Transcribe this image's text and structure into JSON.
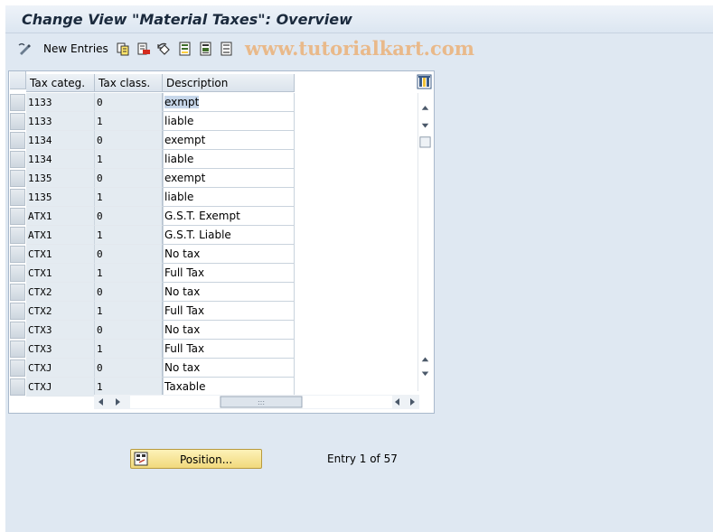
{
  "window": {
    "title": "Change View \"Material Taxes\": Overview"
  },
  "toolbar": {
    "new_entries_label": "New Entries",
    "watermark": "www.tutorialkart.com",
    "icons": [
      "edit-pen-icon",
      "copy-icon",
      "delete-icon",
      "undo-icon",
      "select-all-icon",
      "select-block-icon",
      "deselect-all-icon"
    ]
  },
  "table": {
    "headers": {
      "tax_categ": "Tax categ.",
      "tax_class": "Tax class.",
      "description": "Description"
    },
    "rows": [
      {
        "tax_categ": "1133",
        "tax_class": "0",
        "description": "exmpt"
      },
      {
        "tax_categ": "1133",
        "tax_class": "1",
        "description": "liable"
      },
      {
        "tax_categ": "1134",
        "tax_class": "0",
        "description": "exempt"
      },
      {
        "tax_categ": "1134",
        "tax_class": "1",
        "description": "liable"
      },
      {
        "tax_categ": "1135",
        "tax_class": "0",
        "description": "exempt"
      },
      {
        "tax_categ": "1135",
        "tax_class": "1",
        "description": "liable"
      },
      {
        "tax_categ": "ATX1",
        "tax_class": "0",
        "description": "G.S.T. Exempt"
      },
      {
        "tax_categ": "ATX1",
        "tax_class": "1",
        "description": "G.S.T. Liable"
      },
      {
        "tax_categ": "CTX1",
        "tax_class": "0",
        "description": "No tax"
      },
      {
        "tax_categ": "CTX1",
        "tax_class": "1",
        "description": "Full Tax"
      },
      {
        "tax_categ": "CTX2",
        "tax_class": "0",
        "description": "No tax"
      },
      {
        "tax_categ": "CTX2",
        "tax_class": "1",
        "description": "Full Tax"
      },
      {
        "tax_categ": "CTX3",
        "tax_class": "0",
        "description": "No tax"
      },
      {
        "tax_categ": "CTX3",
        "tax_class": "1",
        "description": "Full Tax"
      },
      {
        "tax_categ": "CTXJ",
        "tax_class": "0",
        "description": "No tax"
      },
      {
        "tax_categ": "CTXJ",
        "tax_class": "1",
        "description": "Taxable"
      }
    ],
    "selected_row": 0
  },
  "footer": {
    "position_label": "Position...",
    "entry_info": "Entry 1 of 57"
  },
  "colors": {
    "background": "#dfe8f2",
    "button": "#f6e39a",
    "key_column": "#e4ebf1",
    "watermark": "#e9b98a"
  }
}
